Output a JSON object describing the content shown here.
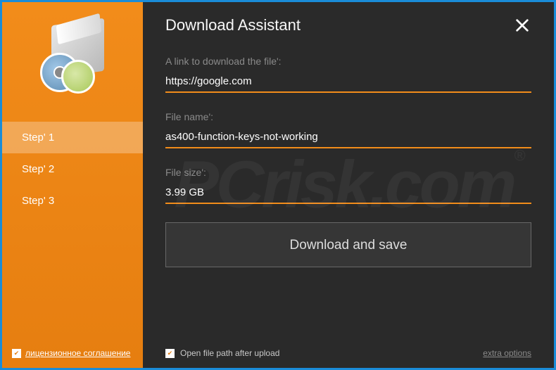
{
  "title": "Download Assistant",
  "sidebar": {
    "steps": [
      "Step' 1",
      "Step' 2",
      "Step' 3"
    ],
    "active_step_index": 0,
    "license": {
      "checked": true,
      "label": "лицензионное соглашение"
    },
    "icon_name": "installer-box-with-discs"
  },
  "fields": {
    "link": {
      "label": "A link to download the file':",
      "value": "https://google.com"
    },
    "name": {
      "label": "File name':",
      "value": "as400-function-keys-not-working"
    },
    "size": {
      "label": "File size':",
      "value": "3.99 GB"
    }
  },
  "download_button": "Download and save",
  "open_path": {
    "checked": true,
    "label": "Open file path after upload"
  },
  "extra_options": "extra options",
  "watermark": "PCrisk.com"
}
